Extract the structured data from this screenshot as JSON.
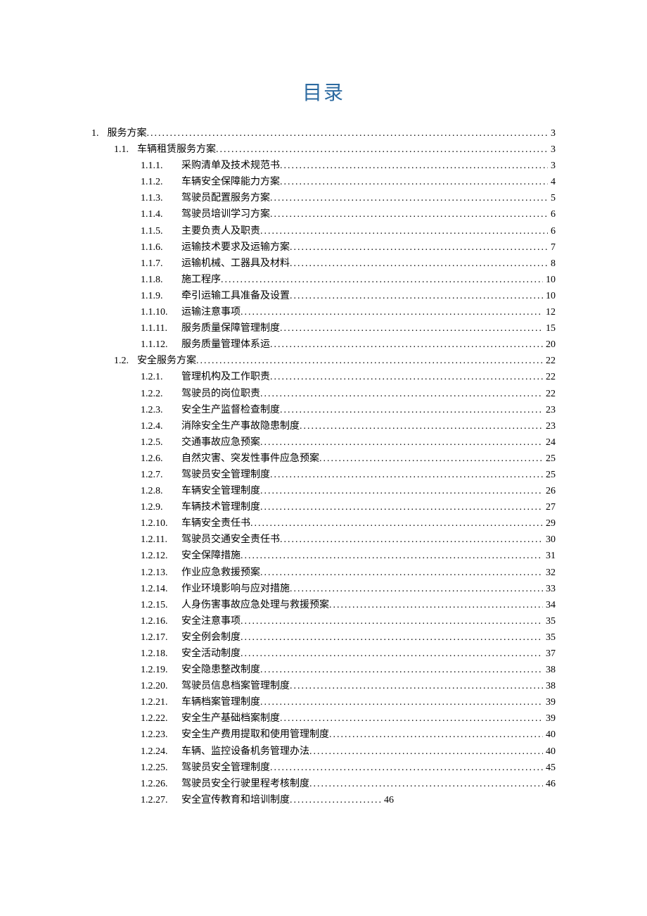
{
  "title": "目录",
  "toc": [
    {
      "level": 1,
      "num": "1.",
      "text": "服务方案",
      "page": "3"
    },
    {
      "level": 2,
      "num": "1.1.",
      "text": "车辆租赁服务方案",
      "page": "3"
    },
    {
      "level": 3,
      "num": "1.1.1.",
      "text": "采购清单及技术规范书",
      "page": "3"
    },
    {
      "level": 3,
      "num": "1.1.2.",
      "text": "车辆安全保障能力方案",
      "page": "4"
    },
    {
      "level": 3,
      "num": "1.1.3.",
      "text": "驾驶员配置服务方案",
      "page": "5"
    },
    {
      "level": 3,
      "num": "1.1.4.",
      "text": "驾驶员培训学习方案",
      "page": "6"
    },
    {
      "level": 3,
      "num": "1.1.5.",
      "text": "主要负责人及职责",
      "page": "6"
    },
    {
      "level": 3,
      "num": "1.1.6.",
      "text": "运输技术要求及运输方案",
      "page": "7"
    },
    {
      "level": 3,
      "num": "1.1.7.",
      "text": "运输机械、工器具及材料",
      "page": "8"
    },
    {
      "level": 3,
      "num": "1.1.8.",
      "text": "施工程序",
      "page": "10"
    },
    {
      "level": 3,
      "num": "1.1.9.",
      "text": "牵引运输工具准备及设置",
      "page": "10"
    },
    {
      "level": 3,
      "num": "1.1.10.",
      "text": "运输注意事项",
      "page": "12"
    },
    {
      "level": 3,
      "num": "1.1.11.",
      "text": "服务质量保障管理制度",
      "page": "15"
    },
    {
      "level": 3,
      "num": "1.1.12.",
      "text": "服务质量管理体系运",
      "page": "20"
    },
    {
      "level": 2,
      "num": "1.2.",
      "text": "安全服务方案",
      "page": "22"
    },
    {
      "level": 3,
      "num": "1.2.1.",
      "text": "管理机构及工作职责",
      "page": "22"
    },
    {
      "level": 3,
      "num": "1.2.2.",
      "text": "驾驶员的岗位职责",
      "page": "22"
    },
    {
      "level": 3,
      "num": "1.2.3.",
      "text": "安全生产监督检查制度",
      "page": "23"
    },
    {
      "level": 3,
      "num": "1.2.4.",
      "text": "消除安全生产事故隐患制度",
      "page": "23"
    },
    {
      "level": 3,
      "num": "1.2.5.",
      "text": "交通事故应急预案",
      "page": "24"
    },
    {
      "level": 3,
      "num": "1.2.6.",
      "text": "自然灾害、突发性事件应急预案",
      "page": "25"
    },
    {
      "level": 3,
      "num": "1.2.7.",
      "text": "驾驶员安全管理制度",
      "page": "25"
    },
    {
      "level": 3,
      "num": "1.2.8.",
      "text": "车辆安全管理制度",
      "page": "26"
    },
    {
      "level": 3,
      "num": "1.2.9.",
      "text": "车辆技术管理制度",
      "page": "27"
    },
    {
      "level": 3,
      "num": "1.2.10.",
      "text": "车辆安全责任书",
      "page": "29"
    },
    {
      "level": 3,
      "num": "1.2.11.",
      "text": "驾驶员交通安全责任书",
      "page": "30"
    },
    {
      "level": 3,
      "num": "1.2.12.",
      "text": "安全保障措施",
      "page": "31"
    },
    {
      "level": 3,
      "num": "1.2.13.",
      "text": "作业应急救援预案",
      "page": "32"
    },
    {
      "level": 3,
      "num": "1.2.14.",
      "text": "作业环境影响与应对措施",
      "page": "33"
    },
    {
      "level": 3,
      "num": "1.2.15.",
      "text": "人身伤害事故应急处理与救援预案",
      "page": "34"
    },
    {
      "level": 3,
      "num": "1.2.16.",
      "text": "安全注意事项",
      "page": "35"
    },
    {
      "level": 3,
      "num": "1.2.17.",
      "text": "安全例会制度",
      "page": "35"
    },
    {
      "level": 3,
      "num": "1.2.18.",
      "text": "安全活动制度",
      "page": "37"
    },
    {
      "level": 3,
      "num": "1.2.19.",
      "text": "安全隐患整改制度",
      "page": "38"
    },
    {
      "level": 3,
      "num": "1.2.20.",
      "text": "驾驶员信息档案管理制度",
      "page": "38"
    },
    {
      "level": 3,
      "num": "1.2.21.",
      "text": "车辆档案管理制度",
      "page": "39"
    },
    {
      "level": 3,
      "num": "1.2.22.",
      "text": "安全生产基础档案制度",
      "page": "39"
    },
    {
      "level": 3,
      "num": "1.2.23.",
      "text": "安全生产费用提取和使用管理制度",
      "page": "40"
    },
    {
      "level": 3,
      "num": "1.2.24.",
      "text": "车辆、监控设备机务管理办法",
      "page": "40"
    },
    {
      "level": 3,
      "num": "1.2.25.",
      "text": "驾驶员安全管理制度",
      "page": "45"
    },
    {
      "level": 3,
      "num": "1.2.26.",
      "text": "驾驶员安全行驶里程考核制度",
      "page": "46"
    },
    {
      "level": 3,
      "num": "1.2.27.",
      "text": "安全宣传教育和培训制度",
      "page": "46",
      "shortDots": true
    }
  ]
}
